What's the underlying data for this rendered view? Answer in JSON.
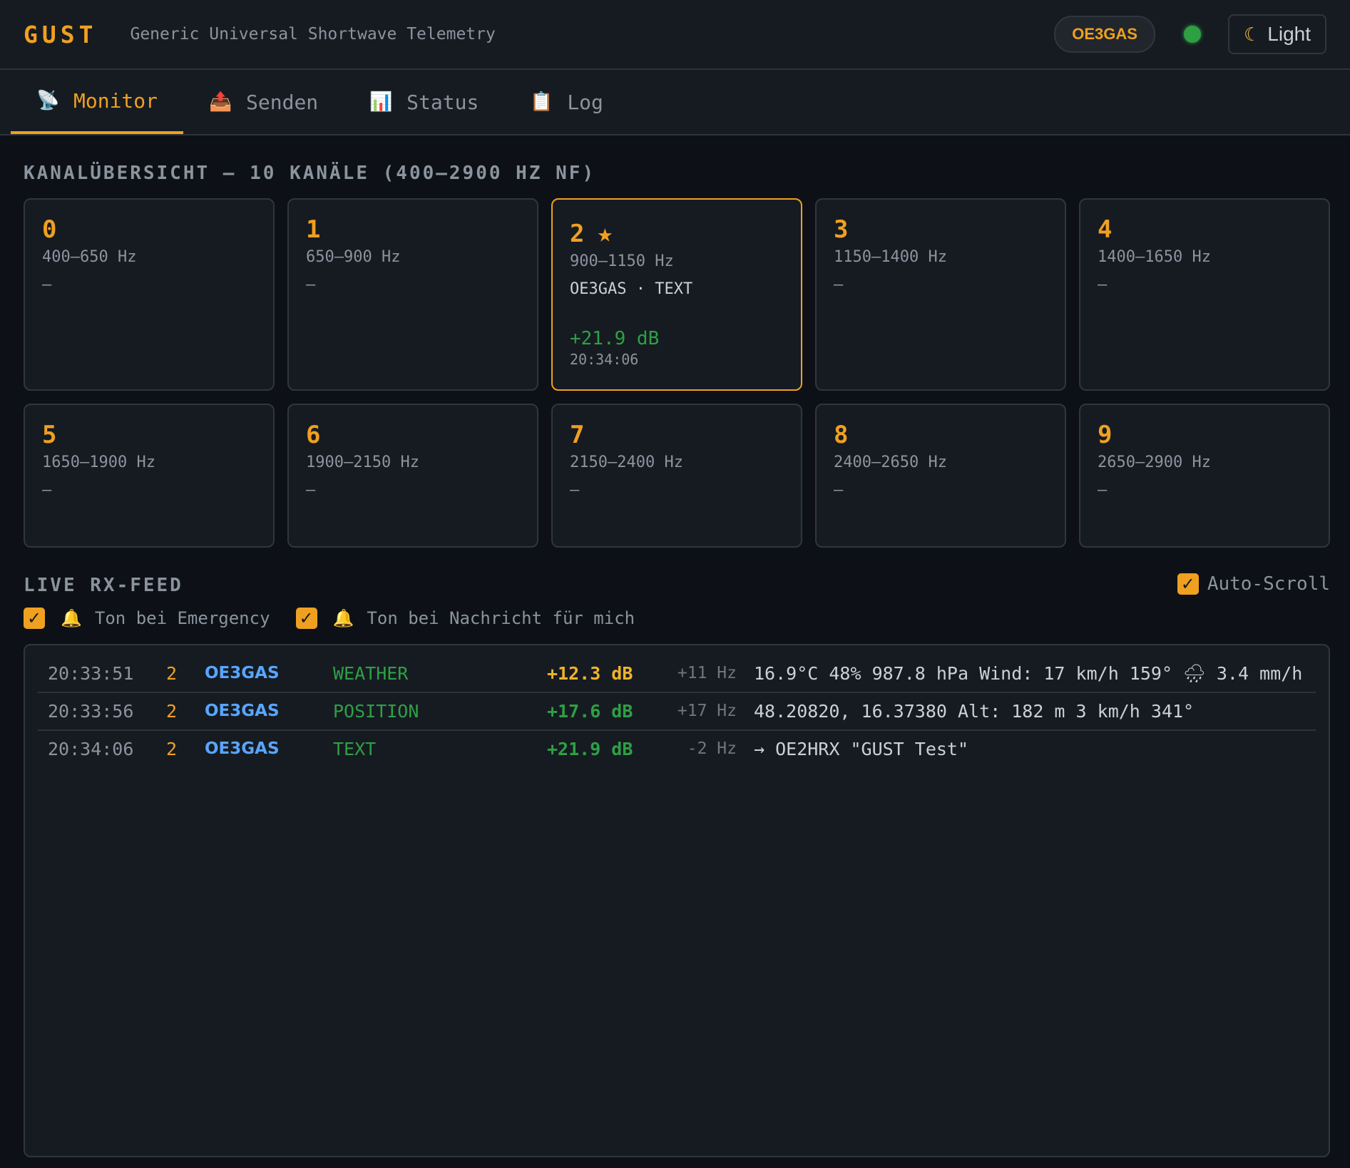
{
  "header": {
    "brand": "GUST",
    "subtitle": "Generic Universal Shortwave Telemetry",
    "callsign": "OE3GAS",
    "theme_label": "Light",
    "theme_icon": "moon-icon",
    "status_color": "#2ea043"
  },
  "tabs": [
    {
      "label": "Monitor",
      "icon": "satellite-dish-icon"
    },
    {
      "label": "Senden",
      "icon": "outbox-tray-icon"
    },
    {
      "label": "Status",
      "icon": "bar-chart-icon"
    },
    {
      "label": "Log",
      "icon": "clipboard-icon"
    }
  ],
  "overview": {
    "title": "KANALÜBERSICHT — 10 KANÄLE (400–2900 HZ NF)",
    "channels": [
      {
        "num": "0",
        "range": "400–650 Hz",
        "info": "—"
      },
      {
        "num": "1",
        "range": "650–900 Hz",
        "info": "—"
      },
      {
        "num": "2",
        "range": "900–1150 Hz",
        "info": "OE3GAS · TEXT",
        "snr": "+21.9 dB",
        "time": "20:34:06",
        "star": "★"
      },
      {
        "num": "3",
        "range": "1150–1400 Hz",
        "info": "—"
      },
      {
        "num": "4",
        "range": "1400–1650 Hz",
        "info": "—"
      },
      {
        "num": "5",
        "range": "1650–1900 Hz",
        "info": "—"
      },
      {
        "num": "6",
        "range": "1900–2150 Hz",
        "info": "—"
      },
      {
        "num": "7",
        "range": "2150–2400 Hz",
        "info": "—"
      },
      {
        "num": "8",
        "range": "2400–2650 Hz",
        "info": "—"
      },
      {
        "num": "9",
        "range": "2650–2900 Hz",
        "info": "—"
      }
    ]
  },
  "feed": {
    "title": "LIVE RX-FEED",
    "autoscroll_label": "Auto-Scroll",
    "check_mark": "✓",
    "bell": "🔔",
    "option_emergency": "Ton bei Emergency",
    "option_message": "Ton bei Nachricht für mich",
    "rows": [
      {
        "time": "20:33:51",
        "ch": "2",
        "call": "OE3GAS",
        "type": "WEATHER",
        "snr": "+12.3 dB",
        "offset": "+11 Hz",
        "msg": "16.9°C 48% 987.8 hPa Wind: 17 km/h 159° 🌧 3.4 mm/h"
      },
      {
        "time": "20:33:56",
        "ch": "2",
        "call": "OE3GAS",
        "type": "POSITION",
        "snr": "+17.6 dB",
        "offset": "+17 Hz",
        "msg": "48.20820, 16.37380 Alt: 182 m 3 km/h 341°"
      },
      {
        "time": "20:34:06",
        "ch": "2",
        "call": "OE3GAS",
        "type": "TEXT",
        "snr": "+21.9 dB",
        "offset": "-2 Hz",
        "msg": "→ OE2HRX \"GUST Test\""
      }
    ]
  }
}
